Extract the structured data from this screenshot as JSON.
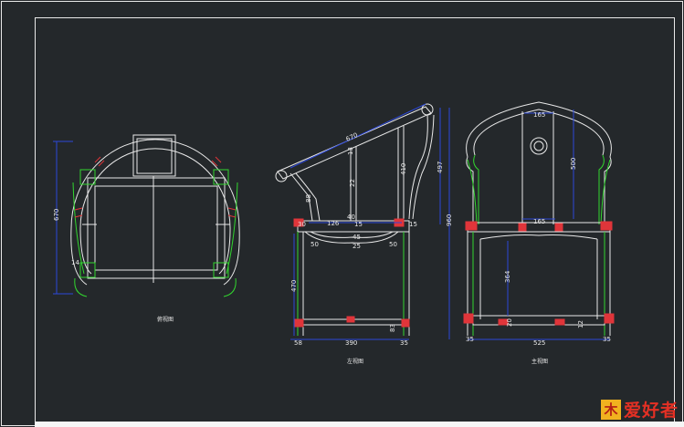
{
  "top_view": {
    "caption": "俯视图",
    "dim_depth": "670",
    "dim_leg": "14"
  },
  "side_view": {
    "caption": "左视图",
    "dim_arm": "670",
    "dim_back_h": "497",
    "dim_total_h": "960",
    "dim_seat_w": "390",
    "dim_top_126": "126",
    "dim_top_40": "40",
    "dim_15a": "15",
    "dim_15b": "15",
    "dim_30": "30",
    "dim_13": "13",
    "dim_22": "22",
    "dim_410": "410",
    "dim_leg_h": "470",
    "dim_58": "58",
    "dim_35": "35",
    "dim_50a": "50",
    "dim_50b": "50",
    "dim_45": "45",
    "dim_25": "25",
    "dim_83": "83",
    "dim_88": "88"
  },
  "front_view": {
    "caption": "主视图",
    "dim_165_top": "165",
    "dim_500": "500",
    "dim_165_mid": "165",
    "dim_364": "364",
    "dim_525": "525",
    "dim_35a": "35",
    "dim_35b": "35",
    "dim_12": "12",
    "dim_20": "20"
  },
  "watermark": {
    "mark": "木",
    "text": "爱好者"
  }
}
